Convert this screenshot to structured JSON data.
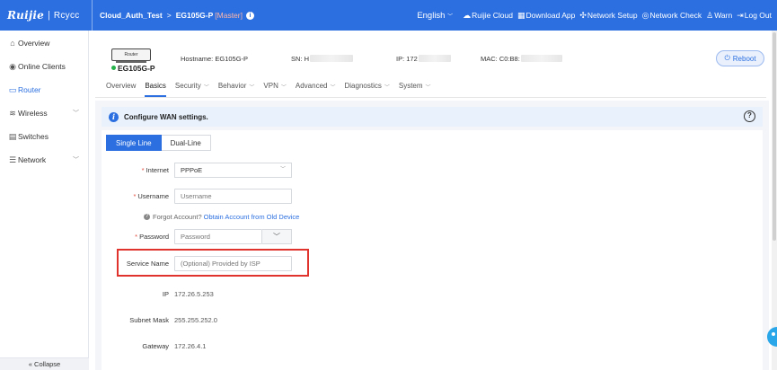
{
  "brand": {
    "logo_primary": "Ruijie",
    "logo_separator": "|",
    "logo_secondary": "Rcycc"
  },
  "breadcrumb": {
    "project": "Cloud_Auth_Test",
    "separator": ">",
    "device": "EG105G-P",
    "role": "[Master]"
  },
  "topnav": {
    "language": "English",
    "items": [
      {
        "icon": "cloud-icon",
        "label": "Ruijie Cloud"
      },
      {
        "icon": "download-icon",
        "label": "Download App"
      },
      {
        "icon": "network-setup-icon",
        "label": "Network Setup"
      },
      {
        "icon": "network-check-icon",
        "label": "Network Check"
      },
      {
        "icon": "warn-icon",
        "label": "Warn"
      },
      {
        "icon": "logout-icon",
        "label": "Log Out"
      }
    ]
  },
  "sidebar": {
    "items": [
      {
        "icon": "overview-icon",
        "label": "Overview",
        "has_children": false
      },
      {
        "icon": "clients-icon",
        "label": "Online Clients",
        "has_children": false
      },
      {
        "icon": "router-icon",
        "label": "Router",
        "has_children": false,
        "active": true
      },
      {
        "icon": "wireless-icon",
        "label": "Wireless",
        "has_children": true
      },
      {
        "icon": "switches-icon",
        "label": "Switches",
        "has_children": false
      },
      {
        "icon": "network-icon",
        "label": "Network",
        "has_children": true
      }
    ],
    "collapse_label": "Collapse"
  },
  "device": {
    "image_label": "Router",
    "name": "EG105G-P",
    "status_color": "#26b24a",
    "hostname_label": "Hostname:",
    "hostname": "EG105G-P",
    "sn_label": "SN:",
    "sn_visible": "H",
    "ip_label": "IP:",
    "ip_visible": "172",
    "mac_label": "MAC:",
    "mac_visible": "C0:B8:",
    "reboot_label": "Reboot"
  },
  "tabs": [
    {
      "label": "Overview",
      "has_menu": false
    },
    {
      "label": "Basics",
      "has_menu": false,
      "active": true
    },
    {
      "label": "Security",
      "has_menu": true
    },
    {
      "label": "Behavior",
      "has_menu": true
    },
    {
      "label": "VPN",
      "has_menu": true
    },
    {
      "label": "Advanced",
      "has_menu": true
    },
    {
      "label": "Diagnostics",
      "has_menu": true
    },
    {
      "label": "System",
      "has_menu": true
    }
  ],
  "notice": {
    "text": "Configure WAN settings."
  },
  "line_mode": {
    "options": [
      "Single Line",
      "Dual-Line"
    ],
    "selected": "Single Line"
  },
  "form": {
    "internet": {
      "label": "Internet",
      "required": true,
      "value": "PPPoE"
    },
    "username": {
      "label": "Username",
      "required": true,
      "placeholder": "Username",
      "value": ""
    },
    "forgot": {
      "text": "Forgot Account?",
      "link": "Obtain Account from Old Device"
    },
    "password": {
      "label": "Password",
      "required": true,
      "placeholder": "Password",
      "value": ""
    },
    "service_name": {
      "label": "Service Name",
      "required": false,
      "placeholder": "(Optional) Provided by ISP",
      "value": ""
    },
    "ip": {
      "label": "IP",
      "value": "172.26.5.253"
    },
    "subnet": {
      "label": "Subnet Mask",
      "value": "255.255.252.0"
    },
    "gateway": {
      "label": "Gateway",
      "value": "172.26.4.1"
    }
  },
  "colors": {
    "accent": "#2b6fe0",
    "highlight": "#e0332d",
    "required": "#e24b3c"
  }
}
